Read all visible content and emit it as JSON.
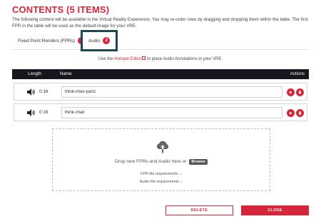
{
  "heading": "CONTENTS (5 ITEMS)",
  "intro": "The following content will be available in the Virtual Reality Experience. You may re-order rows by dragging and dropping them within the table. The first FPR in the table will be used as the default image for your VRE.",
  "tabs": [
    {
      "label": "Fixed Point Renders (FPRs)",
      "count": "3"
    },
    {
      "label": "Audio",
      "count": "2"
    }
  ],
  "hint": {
    "prefix": "Use the ",
    "link": "Hotspot Editor",
    "suffix": " to place Audio Annotations in your VRE."
  },
  "table": {
    "headers": {
      "length": "Length",
      "name": "Name",
      "actions": "Actions"
    },
    "rows": [
      {
        "length": "0:16",
        "name": "think-chair-part2"
      },
      {
        "length": "0:16",
        "name": "think-chair"
      }
    ]
  },
  "dropzone": {
    "text": "Drop new FPRs and Audio here or",
    "browse": "Browse",
    "fpr_req": "FPR file requirements ⌵",
    "audio_req": "Audio file requirements ⌵"
  },
  "footer": {
    "delete": "DELETE",
    "close": "CLOSE"
  },
  "colors": {
    "accent": "#d6263a",
    "dark": "#16161e",
    "tab_highlight": "#1d4553"
  }
}
